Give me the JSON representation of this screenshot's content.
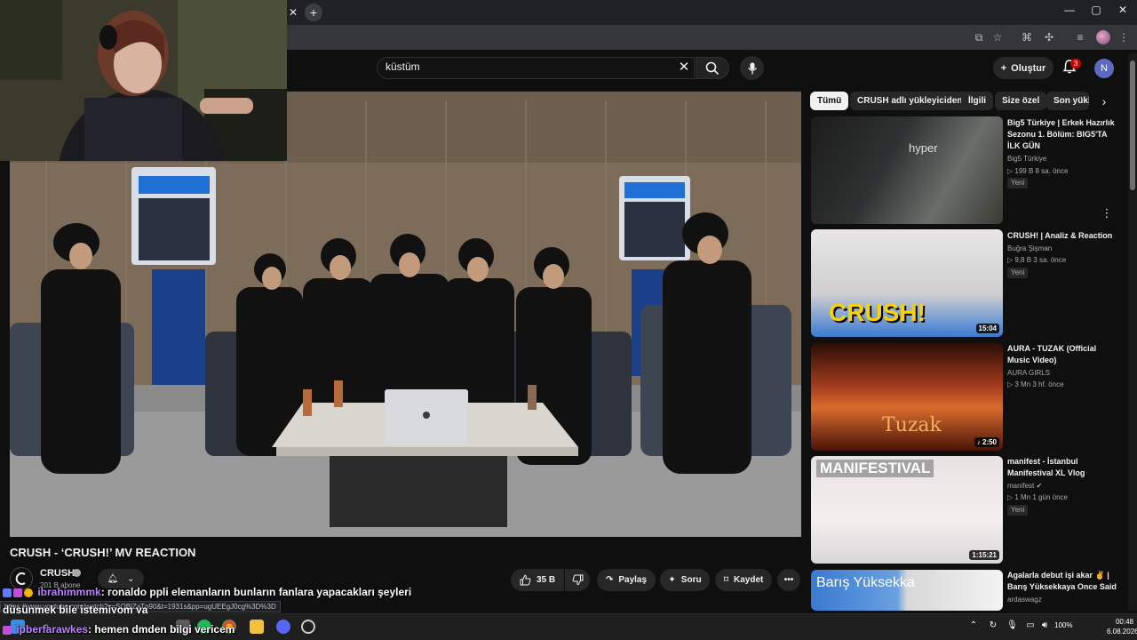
{
  "search": {
    "query": "küstüm"
  },
  "header": {
    "create_label": "Oluştur",
    "notification_count": "3",
    "account_initial": "N"
  },
  "video": {
    "title": "CRUSH - ‘CRUSH!’ MV REACTION",
    "channel": "CRUSH",
    "subscribers": "201 B abone",
    "likes": "35 B",
    "share_label": "Paylaş",
    "ask_label": "Soru",
    "save_label": "Kaydet"
  },
  "chips": [
    "Tümü",
    "CRUSH adlı yükleyiciden",
    "İlgili",
    "Size özel",
    "Son yükl"
  ],
  "recommendations": [
    {
      "title": "Big5 Türkiye | Erkek Hazırlık Sezonu 1. Bölüm: BIG5'TA İLK GÜN",
      "channel": "Big5 Türkiye",
      "meta": "▷ 199 B  8 sa. önce",
      "badge": "Yeni",
      "duration": "",
      "thumb_text": "hyper"
    },
    {
      "title": "CRUSH! | Analiz & Reaction",
      "channel": "Buğra Şişman",
      "meta": "▷ 9,8 B  3 sa. önce",
      "badge": "Yeni",
      "duration": "15:04",
      "thumb_text": "CRUSH!"
    },
    {
      "title": "AURA - TUZAK (Official Music Video)",
      "channel": "AURA GIRLS",
      "meta": "▷ 3 Mn  3 hf. önce",
      "badge": "",
      "duration": "♪ 2:50",
      "thumb_text": "Tuzak"
    },
    {
      "title": "manifest - İstanbul Manifestival XL Vlog",
      "channel": "manifest ✔",
      "meta": "▷ 1 Mn  1 gün önce",
      "badge": "Yeni",
      "duration": "1:15:21",
      "thumb_text": "MANIFESTIVAL"
    },
    {
      "title": "Agalarla debut işi akar ✌️ | Barış Yüksekkaya Once Said",
      "channel": "ardaswagz",
      "meta": "",
      "badge": "",
      "duration": "",
      "thumb_text": "Barış Yüksekka"
    }
  ],
  "chat": [
    {
      "user": "ibrahimmmk",
      "message": ": ronaldo ppli elemanların bunların fanlara yapacakları şeyleri"
    },
    {
      "user": "",
      "message": "düşünmek bile istemiyom ya"
    },
    {
      "user": "ipberfarawkes",
      "message": ": hemen dmden bilgi vericem"
    }
  ],
  "url_preview": "https://www.youtube.com/watch?v=SQBlZaTp90&t=1931s&pp=ugUEEgJ0cg%3D%3D",
  "taskbar": {
    "time": "00:48",
    "date": "6.08.2026",
    "battery": "100%"
  },
  "colors": {
    "background": "#0f0f0f",
    "surface": "#272727",
    "text": "#f1f1f1",
    "muted": "#aaaaaa",
    "accent": "#cc0000",
    "chat_user": "#b884ff"
  }
}
